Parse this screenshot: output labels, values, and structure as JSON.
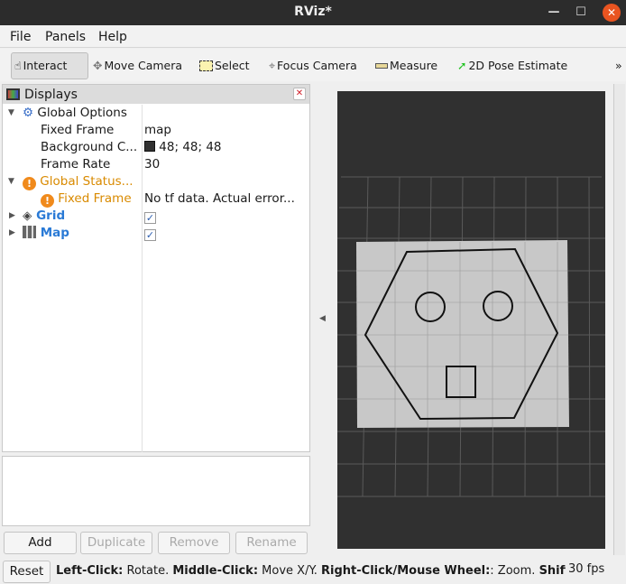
{
  "window": {
    "title": "RViz*"
  },
  "menu": [
    "File",
    "Panels",
    "Help"
  ],
  "toolbar": {
    "interact": "Interact",
    "move_camera": "Move Camera",
    "select": "Select",
    "focus_camera": "Focus Camera",
    "measure": "Measure",
    "pose_estimate": "2D Pose Estimate",
    "more": "»"
  },
  "displays": {
    "title": "Displays",
    "global_options": "Global Options",
    "fixed_frame_label": "Fixed Frame",
    "fixed_frame_value": "map",
    "bg_label": "Background C...",
    "bg_value": "48; 48; 48",
    "bg_color": "#303030",
    "frame_rate_label": "Frame Rate",
    "frame_rate_value": "30",
    "global_status": "Global Status...",
    "status_fixed_frame": "Fixed Frame",
    "status_error": "No tf data.  Actual error...",
    "grid": "Grid",
    "grid_enabled": true,
    "map": "Map",
    "map_enabled": true
  },
  "buttons": {
    "add": "Add",
    "duplicate": "Duplicate",
    "remove": "Remove",
    "rename": "Rename",
    "reset": "Reset"
  },
  "status": {
    "b1": "Left-Click:",
    "t1": " Rotate. ",
    "b2": "Middle-Click:",
    "t2": " Move X/Y. ",
    "b3": "Right-Click/Mouse Wheel:",
    "t3": ": Zoom. ",
    "b4": "Shift"
  },
  "fps": "30 fps"
}
